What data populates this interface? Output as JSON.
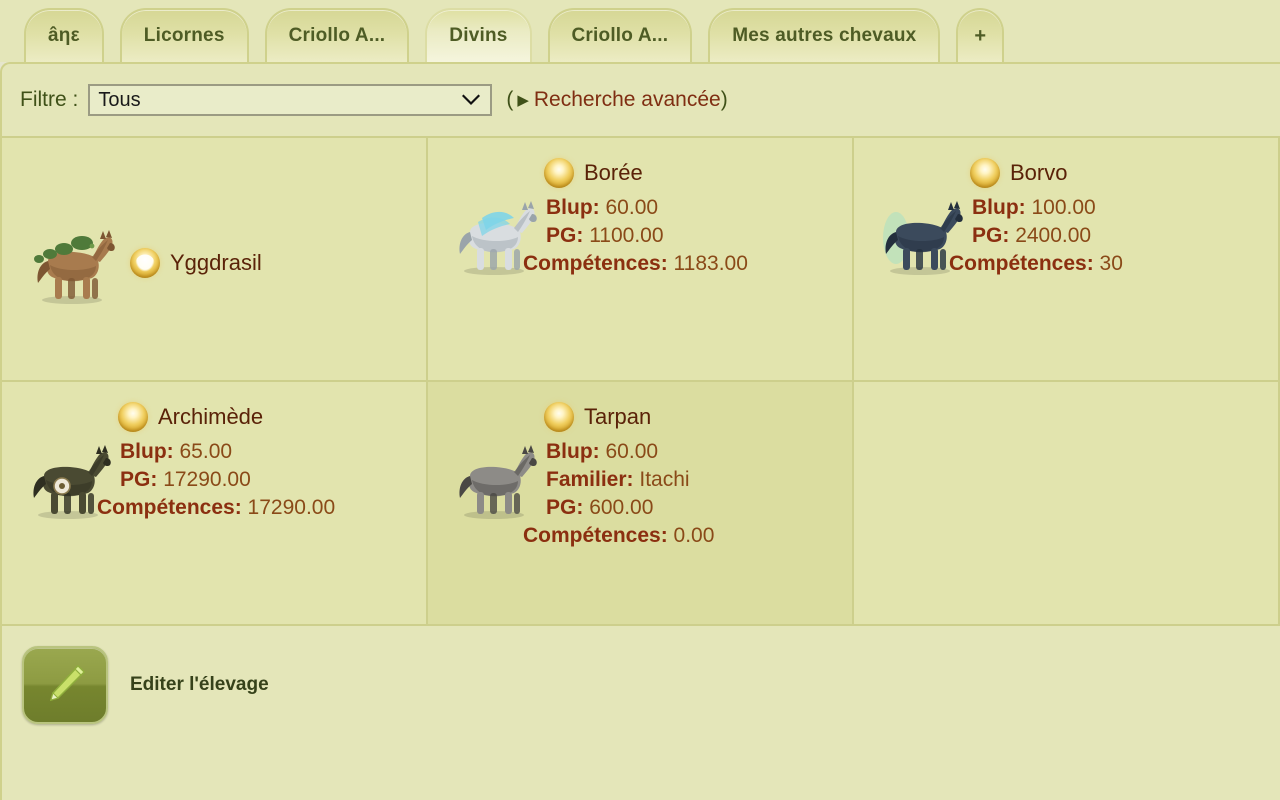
{
  "tabs": [
    {
      "label": "âηε",
      "active": false
    },
    {
      "label": "Licornes",
      "active": false
    },
    {
      "label": "Criollo A...",
      "active": false
    },
    {
      "label": "Divins",
      "active": true
    },
    {
      "label": "Criollo A...",
      "active": false
    },
    {
      "label": "Mes autres chevaux",
      "active": false
    },
    {
      "label": "+",
      "active": false
    }
  ],
  "filter": {
    "label": "Filtre :",
    "selected": "Tous",
    "options": [
      "Tous"
    ],
    "paren_open": "(",
    "paren_close": ")",
    "advanced_link": "Recherche avancée",
    "arrow_glyph": "▶"
  },
  "horses": [
    {
      "name": "Yggdrasil",
      "badge": "tree-badge-icon",
      "sprite": "foal-tree-sprite",
      "layout": "simple",
      "stats": []
    },
    {
      "name": "Borée",
      "badge": "gold-orb-icon",
      "sprite": "pegasus-blue-sprite",
      "layout": "stats",
      "stats": [
        {
          "key": "Blup:",
          "value": "60.00"
        },
        {
          "key": "PG:",
          "value": "1100.00"
        },
        {
          "key": "Compétences:",
          "value": "1183.00"
        }
      ]
    },
    {
      "name": "Borvo",
      "badge": "gold-orb-icon",
      "sprite": "water-horse-sprite",
      "layout": "stats",
      "stats": [
        {
          "key": "Blup:",
          "value": "100.00"
        },
        {
          "key": "PG:",
          "value": "2400.00"
        },
        {
          "key": "Compétences:",
          "value": "30"
        }
      ]
    },
    {
      "name": "Archimède",
      "badge": "gold-orb-icon",
      "sprite": "dark-horse-sprite",
      "layout": "stats",
      "stats": [
        {
          "key": "Blup:",
          "value": "65.00"
        },
        {
          "key": "PG:",
          "value": "17290.00"
        },
        {
          "key": "Compétences:",
          "value": "17290.00"
        }
      ]
    },
    {
      "name": "Tarpan",
      "badge": "gold-orb-icon",
      "sprite": "grey-pony-sprite",
      "layout": "stats",
      "hover": true,
      "stats": [
        {
          "key": "Blup:",
          "value": "60.00"
        },
        {
          "key": "Familier:",
          "value": "Itachi"
        },
        {
          "key": "PG:",
          "value": "600.00"
        },
        {
          "key": "Compétences:",
          "value": "0.00"
        }
      ]
    }
  ],
  "footer": {
    "edit_icon": "pencil-icon",
    "edit_label": "Editer l'élevage"
  },
  "colors": {
    "page_bg": "#e4e6b9",
    "cell_bg": "#e2e4ae",
    "cell_hover_bg": "#dbdda0",
    "grid_line": "#cdcf8c",
    "tab_text": "#4e5c25",
    "stat_key": "#8b2f10",
    "stat_value": "#8a4a18",
    "horse_name": "#5a2208",
    "link": "#7f2e12",
    "filter_label": "#3f5118"
  }
}
